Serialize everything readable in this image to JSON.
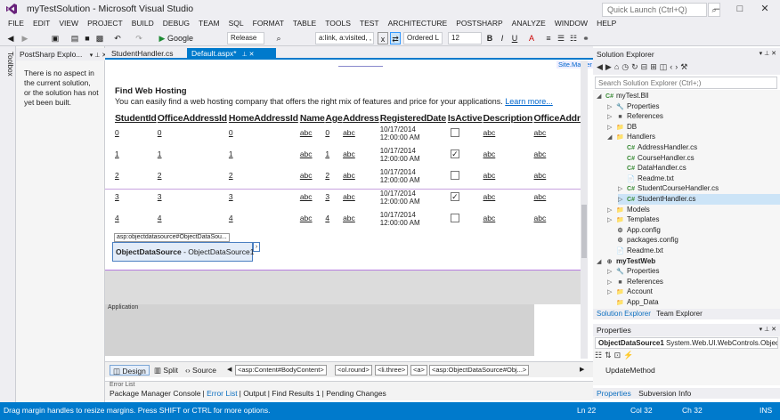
{
  "window": {
    "title": "myTestSolution - Microsoft Visual Studio",
    "quick_launch_placeholder": "Quick Launch (Ctrl+Q)"
  },
  "menu": [
    "FILE",
    "EDIT",
    "VIEW",
    "PROJECT",
    "BUILD",
    "DEBUG",
    "TEAM",
    "SQL",
    "FORMAT",
    "TABLE",
    "TOOLS",
    "TEST",
    "ARCHITECTURE",
    "POSTSHARP",
    "ANALYZE",
    "WINDOW",
    "HELP"
  ],
  "toolbar": {
    "browser": "Google Chrome",
    "configuration": "Release",
    "style_selector": "a:link, a:visited, ,",
    "list_style": "Ordered L",
    "font_size": "12",
    "bold": "B",
    "italic": "I",
    "underline": "U"
  },
  "left_tab": {
    "label": "Toolbox"
  },
  "postsharp": {
    "title": "PostSharp Explo...",
    "message": "There is no aspect in the current solution, or the solution has not yet been built."
  },
  "editor_tabs": [
    {
      "label": "StudentHandler.cs"
    },
    {
      "label": "Default.aspx*"
    }
  ],
  "design": {
    "site_master": "Site.Master",
    "heading": "Find Web Hosting",
    "subtext": "You can easily find a web hosting company that offers the right mix of features and price for your applications.",
    "learn_more": "Learn more...",
    "columns": [
      "StudentId",
      "OfficeAddressId",
      "HomeAddressId",
      "Name",
      "Age",
      "Address",
      "RegisteredDate",
      "IsActive",
      "Description",
      "OfficeAddre"
    ],
    "rows": [
      {
        "StudentId": "0",
        "OfficeAddressId": "0",
        "HomeAddressId": "0",
        "Name": "abc",
        "Age": "0",
        "Address": "abc",
        "date": "10/17/2014",
        "time": "12:00:00 AM",
        "active": false,
        "Description": "abc",
        "Office": "abc"
      },
      {
        "StudentId": "1",
        "OfficeAddressId": "1",
        "HomeAddressId": "1",
        "Name": "abc",
        "Age": "1",
        "Address": "abc",
        "date": "10/17/2014",
        "time": "12:00:00 AM",
        "active": true,
        "Description": "abc",
        "Office": "abc"
      },
      {
        "StudentId": "2",
        "OfficeAddressId": "2",
        "HomeAddressId": "2",
        "Name": "abc",
        "Age": "2",
        "Address": "abc",
        "date": "10/17/2014",
        "time": "12:00:00 AM",
        "active": false,
        "Description": "abc",
        "Office": "abc"
      },
      {
        "StudentId": "3",
        "OfficeAddressId": "3",
        "HomeAddressId": "3",
        "Name": "abc",
        "Age": "3",
        "Address": "abc",
        "date": "10/17/2014",
        "time": "12:00:00 AM",
        "active": true,
        "Description": "abc",
        "Office": "abc"
      },
      {
        "StudentId": "4",
        "OfficeAddressId": "4",
        "HomeAddressId": "4",
        "Name": "abc",
        "Age": "4",
        "Address": "abc",
        "date": "10/17/2014",
        "time": "12:00:00 AM",
        "active": false,
        "Description": "abc",
        "Office": "abc"
      }
    ],
    "ods_tag": "asp:objectdatasource#ObjectDataSou...",
    "ods_name": "ObjectDataSource",
    "ods_id": " - ObjectDataSource1",
    "application_label": "Application"
  },
  "view_bar": {
    "design": "Design",
    "split": "Split",
    "source": "Source",
    "crumbs": [
      "<asp:Content#BodyContent>",
      "<ol.round>",
      "<li.three>",
      "<a>",
      "<asp:ObjectDataSource#Obj...>"
    ]
  },
  "error_list": {
    "title": "Error List",
    "tabs": [
      "Package Manager Console",
      "Error List",
      "Output",
      "Find Results 1",
      "Pending Changes"
    ]
  },
  "solution_explorer": {
    "title": "Solution Explorer",
    "search_placeholder": "Search Solution Explorer (Ctrl+;)",
    "items": [
      {
        "label": "myTest.Bll",
        "icon": "C#",
        "arrow": "◢",
        "indent": 0,
        "bold": false
      },
      {
        "label": "Properties",
        "icon": "🔧",
        "arrow": "▷",
        "indent": 1
      },
      {
        "label": "References",
        "icon": "■",
        "arrow": "▷",
        "indent": 1
      },
      {
        "label": "DB",
        "icon": "📁",
        "arrow": "▷",
        "indent": 1
      },
      {
        "label": "Handlers",
        "icon": "📁",
        "arrow": "◢",
        "indent": 1
      },
      {
        "label": "AddressHandler.cs",
        "icon": "C#",
        "arrow": "",
        "indent": 2
      },
      {
        "label": "CourseHandler.cs",
        "icon": "C#",
        "arrow": "",
        "indent": 2
      },
      {
        "label": "DataHandler.cs",
        "icon": "C#",
        "arrow": "",
        "indent": 2
      },
      {
        "label": "Readme.txt",
        "icon": "📄",
        "arrow": "",
        "indent": 2
      },
      {
        "label": "StudentCourseHandler.cs",
        "icon": "C#",
        "arrow": "▷",
        "indent": 2
      },
      {
        "label": "StudentHandler.cs",
        "icon": "C#",
        "arrow": "▷",
        "indent": 2,
        "selected": true
      },
      {
        "label": "Models",
        "icon": "📁",
        "arrow": "▷",
        "indent": 1
      },
      {
        "label": "Templates",
        "icon": "📁",
        "arrow": "▷",
        "indent": 1
      },
      {
        "label": "App.config",
        "icon": "⚙",
        "arrow": "",
        "indent": 1
      },
      {
        "label": "packages.config",
        "icon": "⚙",
        "arrow": "",
        "indent": 1
      },
      {
        "label": "Readme.txt",
        "icon": "📄",
        "arrow": "",
        "indent": 1
      },
      {
        "label": "myTestWeb",
        "icon": "⊕",
        "arrow": "◢",
        "indent": 0,
        "bold": true
      },
      {
        "label": "Properties",
        "icon": "🔧",
        "arrow": "▷",
        "indent": 1
      },
      {
        "label": "References",
        "icon": "■",
        "arrow": "▷",
        "indent": 1
      },
      {
        "label": "Account",
        "icon": "📁",
        "arrow": "▷",
        "indent": 1
      },
      {
        "label": "App_Data",
        "icon": "📁",
        "arrow": "",
        "indent": 1
      }
    ],
    "tabs": [
      "Solution Explorer",
      "Team Explorer"
    ]
  },
  "properties": {
    "title": "Properties",
    "object": "ObjectDataSource1",
    "object_type": "System.Web.UI.WebControls.Objec",
    "row_label": "UpdateMethod",
    "tabs": [
      "Properties",
      "Subversion Info"
    ]
  },
  "status": {
    "message": "Drag margin handles to resize margins. Press SHIFT or CTRL for more options.",
    "line": "Ln 22",
    "col": "Col 32",
    "ch": "Ch 32",
    "mode": "INS"
  }
}
